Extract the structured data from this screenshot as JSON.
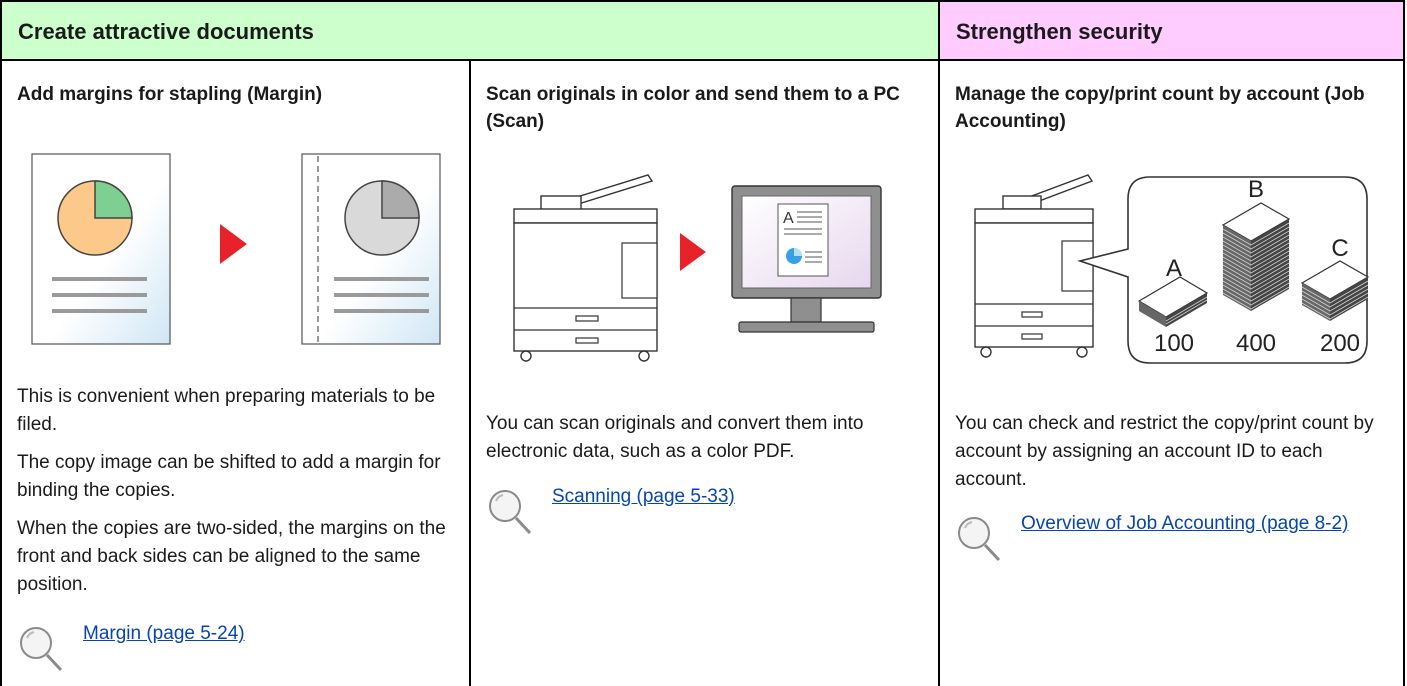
{
  "headers": {
    "left": "Create attractive documents",
    "right": "Strengthen security"
  },
  "columns": [
    {
      "title": "Add margins for stapling (Margin)",
      "paragraphs": [
        "This is convenient when preparing materials to be filed.",
        "The copy image can be shifted to add a margin for binding the copies.",
        "When the copies are two-sided, the margins on the front and back sides can be aligned to the same position."
      ],
      "link": "Margin (page 5-24)"
    },
    {
      "title": "Scan originals in color and send them to a PC (Scan)",
      "paragraphs": [
        "You can scan originals and convert them into electronic data, such as a color PDF."
      ],
      "link": "Scanning (page 5-33)"
    },
    {
      "title": "Manage the copy/print count by account (Job Accounting)",
      "paragraphs": [
        "You can check and restrict the copy/print count by account by assigning an account ID to each account."
      ],
      "link": "Overview of Job Accounting (page 8-2)"
    }
  ],
  "illustration": {
    "monitor_doc_letter": "A",
    "accounts": [
      {
        "label": "A",
        "count": "100"
      },
      {
        "label": "B",
        "count": "400"
      },
      {
        "label": "C",
        "count": "200"
      }
    ]
  },
  "colors": {
    "header_left_bg": "#ccffcc",
    "header_right_bg": "#ffccff",
    "arrow_red": "#e8222a",
    "link_blue": "#0645ad"
  }
}
